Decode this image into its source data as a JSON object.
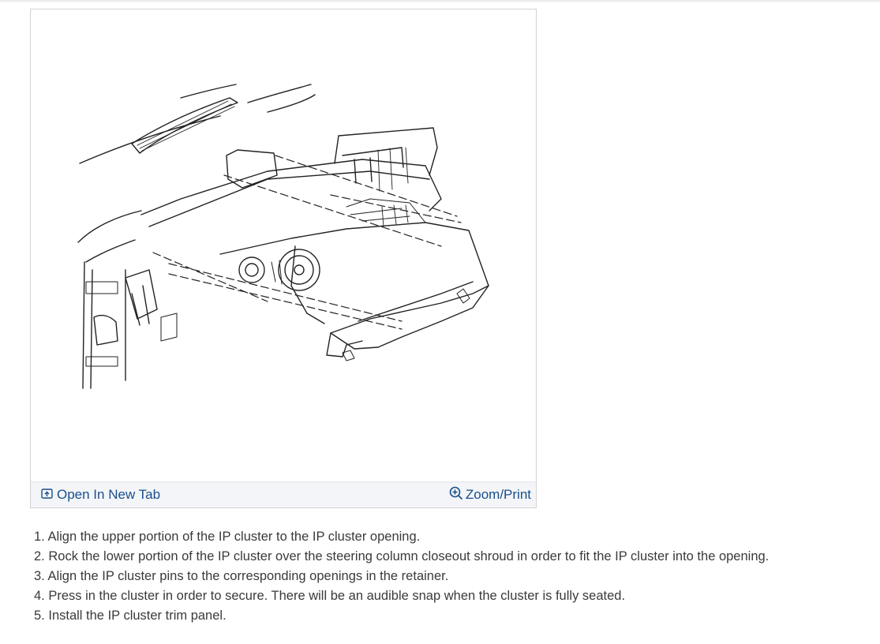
{
  "figure": {
    "toolbar": {
      "open_label": "Open In New Tab",
      "zoom_label": "Zoom/Print",
      "open_icon": "open-new-tab-icon",
      "zoom_icon": "zoom-in-icon"
    }
  },
  "instructions": [
    {
      "number": "1.",
      "text": "Align the upper portion of the IP cluster to the IP cluster opening."
    },
    {
      "number": "2.",
      "text": "Rock the lower portion of the IP cluster over the steering column closeout shroud in order to fit the IP cluster into the opening."
    },
    {
      "number": "3.",
      "text": "Align the IP cluster pins to the corresponding openings in the retainer."
    },
    {
      "number": "4.",
      "text": "Press in the cluster in order to secure. There will be an audible snap when the cluster is fully seated."
    },
    {
      "number": "5.",
      "text": "Install the IP cluster trim panel."
    }
  ],
  "colors": {
    "link": "#1a4f8b",
    "toolbar_bg": "#f3f5f8",
    "border": "#d2d2d2",
    "body_text": "#3a3a3a"
  }
}
